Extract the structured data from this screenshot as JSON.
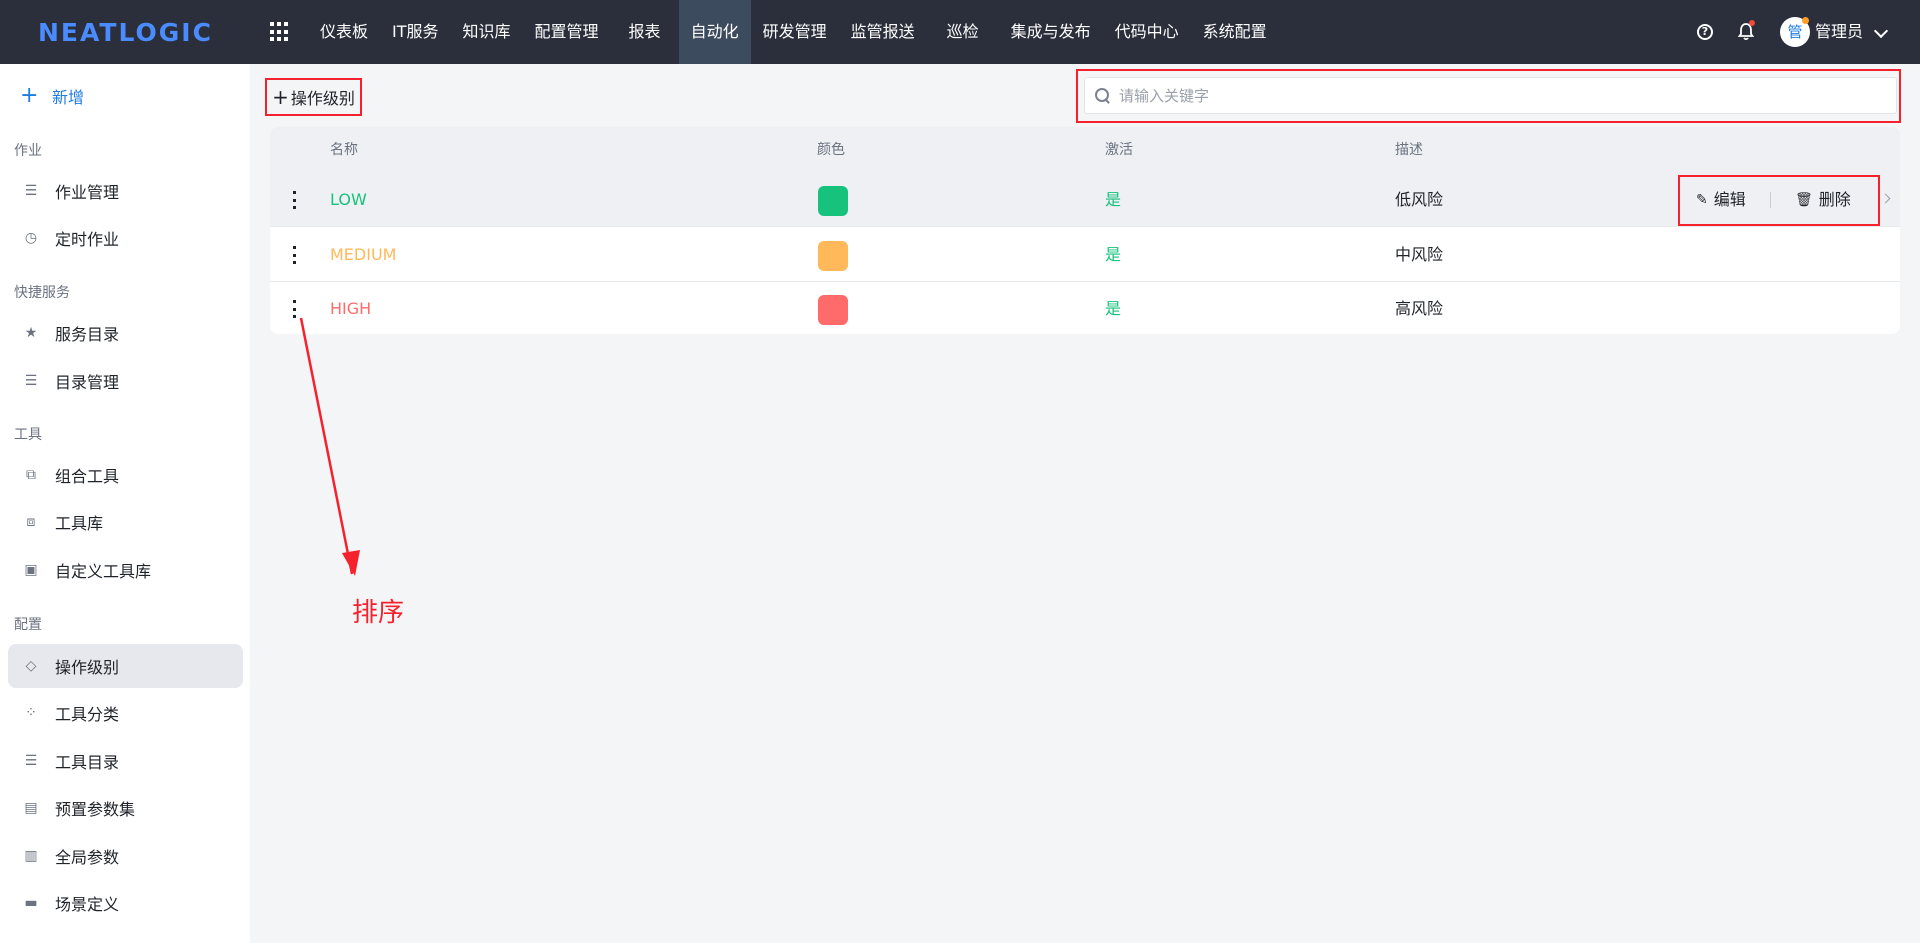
{
  "logo": "NEATLOGIC",
  "nav": {
    "items": [
      "仪表板",
      "IT服务",
      "知识库",
      "配置管理",
      "报表",
      "自动化",
      "研发管理",
      "监管报送",
      "巡检",
      "集成与发布",
      "代码中心",
      "系统配置"
    ],
    "active_index": 5
  },
  "user": {
    "avatar": "管",
    "name": "管理员"
  },
  "sidebar": {
    "new_label": "新增",
    "groups": {
      "job": "作业",
      "quick": "快捷服务",
      "tools": "工具",
      "config": "配置"
    },
    "items": {
      "job_manage": "作业管理",
      "scheduled_job": "定时作业",
      "service_catalog": "服务目录",
      "catalog_manage": "目录管理",
      "combo_tool": "组合工具",
      "tool_library": "工具库",
      "custom_tool_library": "自定义工具库",
      "operation_level": "操作级别",
      "tool_category": "工具分类",
      "tool_catalog": "工具目录",
      "preset_params": "预置参数集",
      "global_params": "全局参数",
      "scene_definition": "场景定义"
    },
    "active": "operation_level"
  },
  "toolbar": {
    "add_label": "操作级别"
  },
  "search": {
    "placeholder": "请输入关键字",
    "value": ""
  },
  "table": {
    "columns": {
      "name": "名称",
      "color": "颜色",
      "active": "激活",
      "desc": "描述"
    },
    "rows": [
      {
        "name": "LOW",
        "color": "#17c27c",
        "active": "是",
        "desc": "低风险"
      },
      {
        "name": "MEDIUM",
        "color": "#ffb95a",
        "active": "是",
        "desc": "中风险"
      },
      {
        "name": "HIGH",
        "color": "#ff6b6b",
        "active": "是",
        "desc": "高风险"
      }
    ],
    "actions": {
      "edit": "编辑",
      "delete": "删除"
    }
  },
  "annotation": {
    "label": "排序"
  },
  "colors": {
    "topbar": "#2b2f3b",
    "active_nav": "#3d4b5e",
    "accent": "#1f7ce0",
    "highlight": "#f5222d",
    "active_text": "#17c27c"
  }
}
